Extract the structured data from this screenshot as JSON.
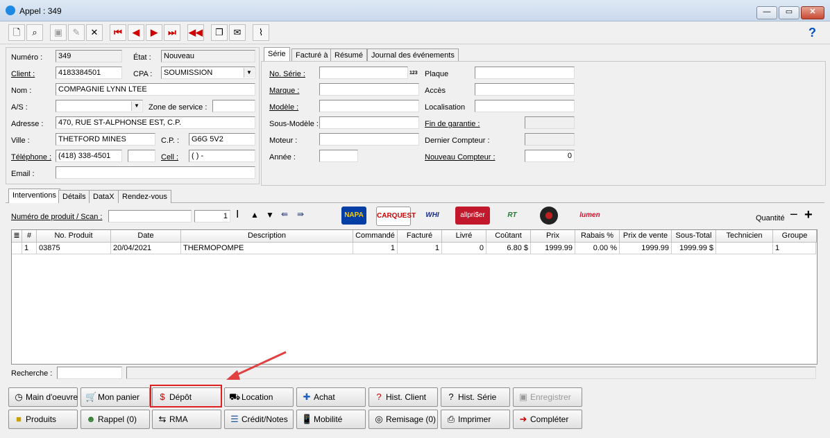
{
  "window": {
    "title": "Appel : 349"
  },
  "left_form": {
    "numero_label": "Numéro :",
    "numero_value": "349",
    "etat_label": "État :",
    "etat_value": "Nouveau",
    "client_label": "Client :",
    "client_value": "4183384501",
    "cpa_label": "CPA :",
    "cpa_value": "SOUMISSION",
    "nom_label": "Nom :",
    "nom_value": "COMPAGNIE LYNN LTEE",
    "as_label": "A/S :",
    "as_value": "",
    "zone_label": "Zone de service :",
    "zone_value": "",
    "adresse_label": "Adresse :",
    "adresse_value": "470, RUE ST-ALPHONSE EST, C.P.",
    "ville_label": "Ville :",
    "ville_value": "THETFORD MINES",
    "cp_label": "C.P. :",
    "cp_value": "G6G 5V2",
    "telephone_label": "Téléphone :",
    "telephone_value": "(418) 338-4501",
    "cell_label": "Cell :",
    "cell_value": "(   )   -",
    "email_label": "Email :",
    "email_value": ""
  },
  "right_tabs": [
    "Série",
    "Facturé à",
    "Résumé",
    "Journal des événements"
  ],
  "serie": {
    "no_serie_label": "No. Série :",
    "no_serie_suffix": "123",
    "marque_label": "Marque :",
    "modele_label": "Modèle :",
    "sous_modele_label": "Sous-Modèle :",
    "moteur_label": "Moteur :",
    "annee_label": "Année :",
    "plaque_label": "Plaque",
    "acces_label": "Accès",
    "localisation_label": "Localisation",
    "fin_garantie_label": "Fin de garantie :",
    "dernier_compteur_label": "Dernier Compteur :",
    "nouveau_compteur_label": "Nouveau Compteur :",
    "nouveau_compteur_value": "0"
  },
  "lower_tabs": [
    "Interventions",
    "Détails",
    "DataX",
    "Rendez-vous"
  ],
  "scan": {
    "label": "Numéro de produit / Scan :",
    "qty_value": "1",
    "quantite_label": "Quantité"
  },
  "logos": [
    "NAPA",
    "CARQUEST",
    "WHI",
    "allpri$er",
    "RT",
    "",
    "lumen"
  ],
  "grid": {
    "headers": [
      "",
      "#",
      "No. Produit",
      "Date",
      "Description",
      "Commandé",
      "Facturé",
      "Livré",
      "Coûtant",
      "Prix",
      "Rabais %",
      "Prix de vente",
      "Sous-Total",
      "Technicien",
      "Groupe"
    ],
    "rows": [
      [
        "",
        "1",
        "03875",
        "20/04/2021",
        "THERMOPOMPE",
        "1",
        "1",
        "0",
        "6.80 $",
        "1999.99",
        "0.00 %",
        "1999.99",
        "1999.99 $",
        "",
        "1"
      ]
    ]
  },
  "search": {
    "label": "Recherche :"
  },
  "buttons_row1": [
    {
      "label": "Main d'oeuvre",
      "icon": "clock-icon"
    },
    {
      "label": "Mon panier",
      "icon": "cart-icon"
    },
    {
      "label": "Dépôt",
      "icon": "deposit-icon"
    },
    {
      "label": "Location",
      "icon": "forklift-icon"
    },
    {
      "label": "Achat",
      "icon": "purchase-icon"
    },
    {
      "label": "Hist. Client",
      "icon": "history-icon"
    },
    {
      "label": "Hist. Série",
      "icon": "history-icon"
    },
    {
      "label": "Enregistrer",
      "icon": "save-icon"
    }
  ],
  "buttons_row2": [
    {
      "label": "Produits",
      "icon": "box-icon"
    },
    {
      "label": "Rappel (0)",
      "icon": "person-icon"
    },
    {
      "label": "RMA",
      "icon": "rma-icon"
    },
    {
      "label": "Crédit/Notes",
      "icon": "list-icon"
    },
    {
      "label": "Mobilité",
      "icon": "phone-icon"
    },
    {
      "label": "Remisage (0)",
      "icon": "tire-icon"
    },
    {
      "label": "Imprimer",
      "icon": "printer-icon"
    },
    {
      "label": "Compléter",
      "icon": "arrow-right-icon"
    }
  ]
}
